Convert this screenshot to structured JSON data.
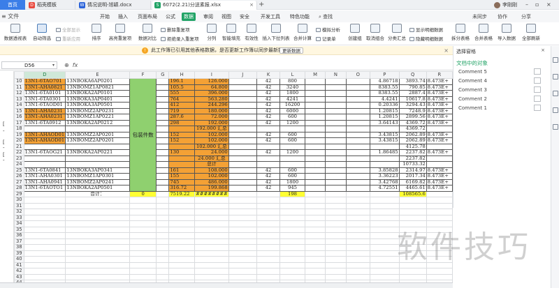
{
  "tabs": {
    "home": "首页",
    "items": [
      {
        "label": "稻壳模板",
        "color": "#e94a3f",
        "glyph": "D"
      },
      {
        "label": "情况说明-旭颖.docx",
        "color": "#2b63d9",
        "glyph": "W"
      },
      {
        "label": "6072(2.21)分送素报.xlsx",
        "color": "#21a366",
        "glyph": "S"
      }
    ],
    "plus": "+",
    "sync": "未同步",
    "coop": "协作",
    "user": "李刚刚"
  },
  "menu": {
    "file": "≡ 文件",
    "items": [
      "开始",
      "插入",
      "页面布局",
      "公式",
      "数据",
      "审阅",
      "视图",
      "安全",
      "开发工具",
      "特色功能"
    ],
    "active": "数据",
    "search": "查找",
    "right": [
      "未同步",
      "协作",
      "分享"
    ]
  },
  "ribbon": {
    "big": [
      "数据透视表",
      "自动筛选",
      "排序",
      "高亮重复项",
      "数据对比",
      "分列",
      "智能填充",
      "有效性",
      "插入下拉列表",
      "合并计算",
      "创建组",
      "取消组合",
      "分类汇总",
      "拆分表格",
      "合并表格",
      "导入数据",
      "全部刷新"
    ],
    "selected": "自动筛选",
    "small": [
      "全部显示",
      "重新应用",
      "删除重复项",
      "拒绝录入重复项",
      "模拟分析",
      "记录单",
      "显示明细数据",
      "隐藏明细数据"
    ]
  },
  "notice": {
    "message": "此工作簿已引用其他表格数据，是否更新工作簿以同步最新数据？",
    "button": "更新数据",
    "close": "×"
  },
  "formula": {
    "cell": "D56",
    "fx": "fx"
  },
  "grid": {
    "columns": [
      "D",
      "E",
      "F",
      "G",
      "H",
      "I",
      "J",
      "K",
      "L",
      "M",
      "N",
      "O",
      "P",
      "Q",
      "R"
    ],
    "selected_column": "D",
    "rows": [
      {
        "n": "10",
        "D": "13N1-6TAO701",
        "E": "13NBOKA6AP0201",
        "H": "196.1",
        "I": "126.000",
        "K": "42",
        "L": "800",
        "P": "4.86718",
        "Q": "3893.74",
        "R": "8.473E+"
      },
      {
        "n": "11",
        "D": "13N1-AHA0821",
        "E": "13NBOMZ1AP0821",
        "H": "105.5",
        "I": "64.800",
        "K": "42",
        "L": "3240",
        "P": "8383.55",
        "Q": "790.85",
        "R": "8.473E+"
      },
      {
        "n": "12",
        "D": "13N1-6TA0101",
        "E": "13NBOKA2AP0101",
        "H": "555",
        "I": "396.000",
        "K": "42",
        "L": "1800",
        "P": "8383.55",
        "Q": "2887.4",
        "R": "8.473E+"
      },
      {
        "n": "13",
        "D": "13N1-6TA0301",
        "E": "13NBOKA3AP0401",
        "H": "764",
        "I": "563.280",
        "K": "42",
        "L": "4241",
        "P": "4.4241",
        "Q": "10617.8",
        "R": "8.473E+"
      },
      {
        "n": "14",
        "D": "13N1-6TAOD01",
        "E": "13NBOKA3AP0501",
        "H": "412",
        "I": "244.296",
        "K": "42",
        "L": "16200",
        "P": "0.20336",
        "Q": "3294.43",
        "R": "8.473E+"
      },
      {
        "n": "15",
        "D": "13N1-AHA0231",
        "E": "13NBOMZ2AP0231",
        "H": "719",
        "I": "180.000",
        "K": "42",
        "L": "6000",
        "P": "1.20815",
        "Q": "7248.9",
        "R": "8.473E+"
      },
      {
        "n": "16",
        "D": "13N1-AHA0231",
        "E": "13NBOMZ1AP0221",
        "H": "287.6",
        "I": "72.000",
        "K": "42",
        "L": "600",
        "P": "1.20815",
        "Q": "2899.56",
        "R": "8.473E+"
      },
      {
        "n": "17",
        "D": "13N1-6TA0912",
        "E": "13NBOKA2AP0212",
        "H": "298",
        "I": "192.000",
        "K": "42",
        "L": "1200",
        "P": "3.64143",
        "Q": "4369.72",
        "R": "8.473E+"
      },
      {
        "n": "18",
        "sub": "192.000 汇总",
        "Q": "4369.72"
      },
      {
        "n": "19",
        "D": "13N1-AHAOD01",
        "E": "13NBOMZ2AP0201",
        "H": "152",
        "I": "102.000",
        "K": "42",
        "L": "600",
        "P": "3.43815",
        "Q": "2062.89",
        "R": "8.473E+"
      },
      {
        "n": "20",
        "D": "13N1-AHAOD01",
        "E": "13NBOMZ2AP0201",
        "H": "152",
        "I": "102.000",
        "K": "42",
        "L": "600",
        "P": "3.43815",
        "Q": "2062.89",
        "R": "8.473E+"
      },
      {
        "n": "21",
        "sub": "102.000 汇总",
        "Q": "4125.78"
      },
      {
        "n": "22",
        "D": "13N1-6TAOG21",
        "E": "13NBOKA2AP0221",
        "H": "130",
        "I": "24.000",
        "K": "42",
        "L": "1200",
        "P": "1.86485",
        "Q": "2237.82",
        "R": "8.473E+"
      },
      {
        "n": "23",
        "sub": "24.000 汇总",
        "Q": "2237.82"
      },
      {
        "n": "24",
        "sub": "总计",
        "Q": "10733.32"
      },
      {
        "n": "25",
        "D": "13N1-6TA0841",
        "E": "13NBOKA3AP0341",
        "H": "161",
        "I": "108.000",
        "K": "42",
        "L": "600",
        "P": "3.85828",
        "Q": "2314.97",
        "R": "8.473E+"
      },
      {
        "n": "26",
        "D": "13N1-AHA0301",
        "E": "13NBOMZ1AP0301",
        "H": "155",
        "I": "102.000",
        "K": "42",
        "L": "600",
        "P": "3.36223",
        "Q": "2017.34",
        "R": "8.473E+"
      },
      {
        "n": "27",
        "D": "13N1-AHA0941",
        "E": "13NBOMZ2AP0241",
        "H": "745",
        "I": "486.000",
        "K": "42",
        "L": "1800",
        "P": "3.42768",
        "Q": "6169.82",
        "R": "8.473E+"
      },
      {
        "n": "28",
        "D": "13N1-6TAOTO1",
        "E": "13NBOKA2AP0501",
        "H": "316.72",
        "I": "199.868",
        "K": "42",
        "L": "945",
        "P": "4.72551",
        "Q": "4465.61",
        "R": "8.473E+"
      },
      {
        "n": "29",
        "total_label": "合计：",
        "F": "0",
        "H": "7519.22",
        "I": "########",
        "L": "198",
        "Q": "108565.6"
      },
      {
        "n": "30"
      },
      {
        "n": "31"
      },
      {
        "n": "32"
      },
      {
        "n": "33"
      },
      {
        "n": "34"
      },
      {
        "n": "35"
      },
      {
        "n": "36"
      },
      {
        "n": "37"
      },
      {
        "n": "38"
      },
      {
        "n": "39"
      },
      {
        "n": "40"
      },
      {
        "n": "41"
      },
      {
        "n": "42"
      },
      {
        "n": "43"
      },
      {
        "n": "44"
      },
      {
        "n": "45"
      }
    ],
    "merged_F_label": "包装件数"
  },
  "outline": {
    "marks": [
      "1",
      "2",
      "3"
    ]
  },
  "pane": {
    "header": "选择窗格",
    "close": "×",
    "title": "文档中的对象",
    "objects": [
      "Comment 5",
      "Comment 4",
      "Comment 3",
      "Comment 2",
      "Comment 1"
    ]
  },
  "watermark": "软件技巧",
  "colors": {
    "accent": "#21a366",
    "orange": "#f4a135",
    "green_fill": "#8fd06f",
    "yellow": "#ffff33"
  }
}
